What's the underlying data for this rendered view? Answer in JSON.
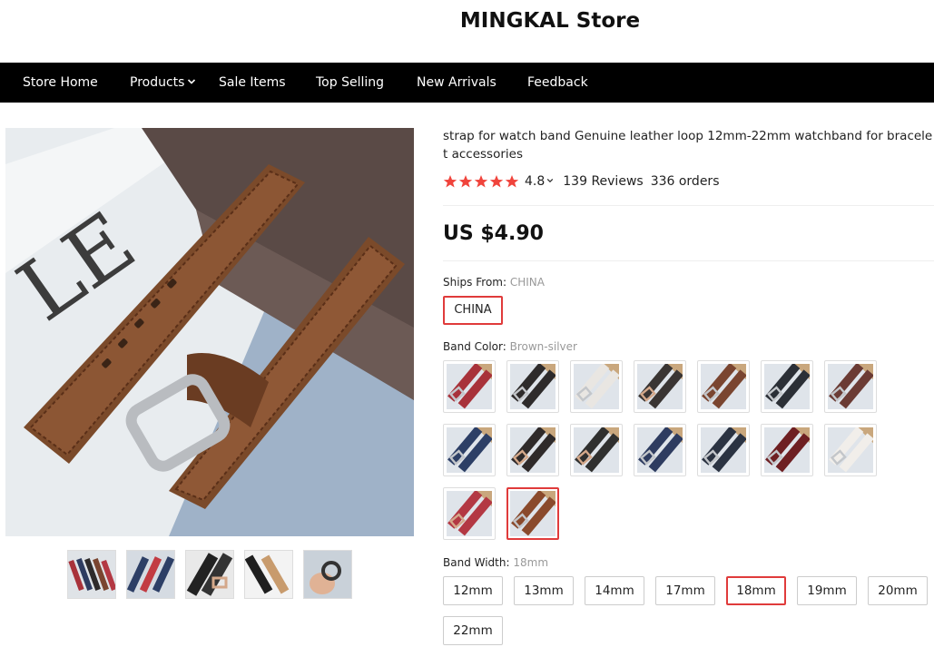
{
  "store": {
    "title": "MINGKAL Store"
  },
  "nav": {
    "items": [
      {
        "label": "Store Home"
      },
      {
        "label": "Products",
        "has_dropdown": true
      },
      {
        "label": "Sale Items"
      },
      {
        "label": "Top Selling"
      },
      {
        "label": "New Arrivals"
      },
      {
        "label": "Feedback"
      }
    ]
  },
  "product": {
    "title": "strap for watch band Genuine leather loop 12mm-22mm watchband for bracelet accessories",
    "rating": "4.8",
    "reviews": "139 Reviews",
    "orders": "336 orders",
    "price": "US $4.90",
    "star_color": "#f0443c"
  },
  "ships_from": {
    "label": "Ships From:",
    "value": "CHINA",
    "options": [
      "CHINA"
    ]
  },
  "band_color": {
    "label": "Band Color:",
    "value": "Brown-silver",
    "swatches": [
      {
        "strap": "#a8323a",
        "buckle": "silver"
      },
      {
        "strap": "#2e2b2b",
        "buckle": "silver"
      },
      {
        "strap": "#e9e6e2",
        "buckle": "silver"
      },
      {
        "strap": "#3a3533",
        "buckle": "rose"
      },
      {
        "strap": "#7a4530",
        "buckle": "silver"
      },
      {
        "strap": "#2b2f36",
        "buckle": "silver"
      },
      {
        "strap": "#6b3b34",
        "buckle": "silver"
      },
      {
        "strap": "#2d3f66",
        "buckle": "silver"
      },
      {
        "strap": "#2f2a2a",
        "buckle": "rose"
      },
      {
        "strap": "#30302f",
        "buckle": "rose"
      },
      {
        "strap": "#2e3c60",
        "buckle": "silver"
      },
      {
        "strap": "#2b3342",
        "buckle": "silver"
      },
      {
        "strap": "#6e1f22",
        "buckle": "silver"
      },
      {
        "strap": "#f1eeea",
        "buckle": "silver"
      },
      {
        "strap": "#b33843",
        "buckle": "rose"
      },
      {
        "strap": "#8a4a2c",
        "buckle": "silver",
        "selected": true
      }
    ]
  },
  "band_width": {
    "label": "Band Width:",
    "value": "18mm",
    "options": [
      {
        "label": "12mm"
      },
      {
        "label": "13mm"
      },
      {
        "label": "14mm"
      },
      {
        "label": "17mm"
      },
      {
        "label": "18mm",
        "selected": true
      },
      {
        "label": "19mm"
      },
      {
        "label": "20mm"
      },
      {
        "label": "22mm"
      }
    ]
  },
  "gallery": {
    "thumbnails": [
      {
        "icon": "multicolor-straps-thumbnail"
      },
      {
        "icon": "blue-red-straps-thumbnail"
      },
      {
        "icon": "black-strap-rose-buckle-thumbnail"
      },
      {
        "icon": "black-strap-tan-lining-thumbnail"
      },
      {
        "icon": "hand-holding-loop-thumbnail"
      }
    ]
  }
}
